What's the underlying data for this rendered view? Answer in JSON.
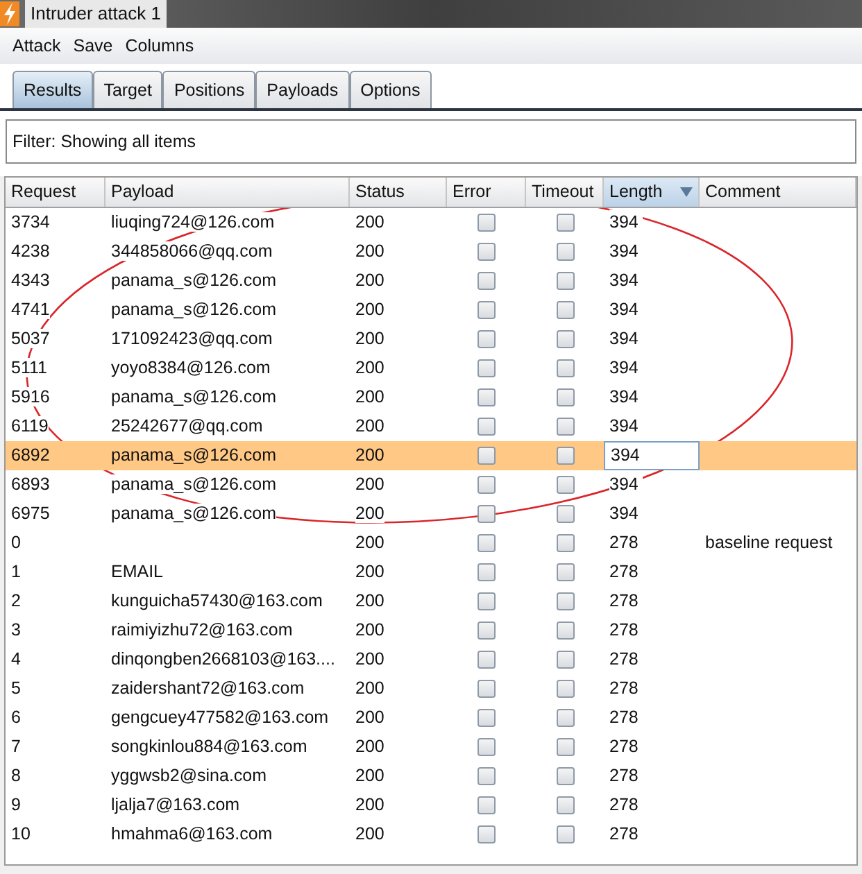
{
  "window": {
    "title": "Intruder attack 1"
  },
  "menu": [
    "Attack",
    "Save",
    "Columns"
  ],
  "tabs": [
    {
      "label": "Results",
      "selected": true
    },
    {
      "label": "Target",
      "selected": false
    },
    {
      "label": "Positions",
      "selected": false
    },
    {
      "label": "Payloads",
      "selected": false
    },
    {
      "label": "Options",
      "selected": false
    }
  ],
  "filter": "Filter: Showing all items",
  "table": {
    "columns": [
      {
        "label": "Request",
        "sorted": false
      },
      {
        "label": "Payload",
        "sorted": false
      },
      {
        "label": "Status",
        "sorted": false
      },
      {
        "label": "Error",
        "sorted": false
      },
      {
        "label": "Timeout",
        "sorted": false
      },
      {
        "label": "Length",
        "sorted": true
      },
      {
        "label": "Comment",
        "sorted": false
      }
    ],
    "rows": [
      {
        "request": "3734",
        "payload": "liuqing724@126.com",
        "status": "200",
        "error": false,
        "timeout": false,
        "length": "394",
        "selected": false,
        "length_focused": false
      },
      {
        "request": "4238",
        "payload": "344858066@qq.com",
        "status": "200",
        "error": false,
        "timeout": false,
        "length": "394",
        "selected": false,
        "length_focused": false
      },
      {
        "request": "4343",
        "payload": "panama_s@126.com",
        "status": "200",
        "error": false,
        "timeout": false,
        "length": "394",
        "selected": false,
        "length_focused": false
      },
      {
        "request": "4741",
        "payload": "panama_s@126.com",
        "status": "200",
        "error": false,
        "timeout": false,
        "length": "394",
        "selected": false,
        "length_focused": false
      },
      {
        "request": "5037",
        "payload": "171092423@qq.com",
        "status": "200",
        "error": false,
        "timeout": false,
        "length": "394",
        "selected": false,
        "length_focused": false
      },
      {
        "request": "5111",
        "payload": "yoyo8384@126.com",
        "status": "200",
        "error": false,
        "timeout": false,
        "length": "394",
        "selected": false,
        "length_focused": false
      },
      {
        "request": "5916",
        "payload": "panama_s@126.com",
        "status": "200",
        "error": false,
        "timeout": false,
        "length": "394",
        "selected": false,
        "length_focused": false
      },
      {
        "request": "6119",
        "payload": "25242677@qq.com",
        "status": "200",
        "error": false,
        "timeout": false,
        "length": "394",
        "selected": false,
        "length_focused": false
      },
      {
        "request": "6892",
        "payload": "panama_s@126.com",
        "status": "200",
        "error": false,
        "timeout": false,
        "length": "394",
        "selected": true,
        "length_focused": true
      },
      {
        "request": "6893",
        "payload": "panama_s@126.com",
        "status": "200",
        "error": false,
        "timeout": false,
        "length": "394",
        "selected": false,
        "length_focused": false
      },
      {
        "request": "6975",
        "payload": "panama_s@126.com",
        "status": "200",
        "error": false,
        "timeout": false,
        "length": "394",
        "selected": false,
        "length_focused": false
      },
      {
        "request": "0",
        "status": "200",
        "error": false,
        "timeout": false,
        "length": "278",
        "comment": "baseline request",
        "selected": false,
        "length_focused": false
      },
      {
        "request": "1",
        "payload": "EMAIL",
        "status": "200",
        "error": false,
        "timeout": false,
        "length": "278",
        "selected": false,
        "length_focused": false
      },
      {
        "request": "2",
        "payload": "kunguicha57430@163.com",
        "status": "200",
        "error": false,
        "timeout": false,
        "length": "278",
        "selected": false,
        "length_focused": false
      },
      {
        "request": "3",
        "payload": "raimiyizhu72@163.com",
        "status": "200",
        "error": false,
        "timeout": false,
        "length": "278",
        "selected": false,
        "length_focused": false
      },
      {
        "request": "4",
        "payload": "dinqongben2668103@163....",
        "status": "200",
        "error": false,
        "timeout": false,
        "length": "278",
        "selected": false,
        "length_focused": false
      },
      {
        "request": "5",
        "payload": "zaidershant72@163.com",
        "status": "200",
        "error": false,
        "timeout": false,
        "length": "278",
        "selected": false,
        "length_focused": false
      },
      {
        "request": "6",
        "payload": "gengcuey477582@163.com",
        "status": "200",
        "error": false,
        "timeout": false,
        "length": "278",
        "selected": false,
        "length_focused": false
      },
      {
        "request": "7",
        "payload": "songkinlou884@163.com",
        "status": "200",
        "error": false,
        "timeout": false,
        "length": "278",
        "selected": false,
        "length_focused": false
      },
      {
        "request": "8",
        "payload": "yggwsb2@sina.com",
        "status": "200",
        "error": false,
        "timeout": false,
        "length": "278",
        "selected": false,
        "length_focused": false
      },
      {
        "request": "9",
        "payload": "ljalja7@163.com",
        "status": "200",
        "error": false,
        "timeout": false,
        "length": "278",
        "selected": false,
        "length_focused": false
      },
      {
        "request": "10",
        "payload": "hmahma6@163.com",
        "status": "200",
        "error": false,
        "timeout": false,
        "length": "278",
        "selected": false,
        "length_focused": false
      }
    ]
  }
}
